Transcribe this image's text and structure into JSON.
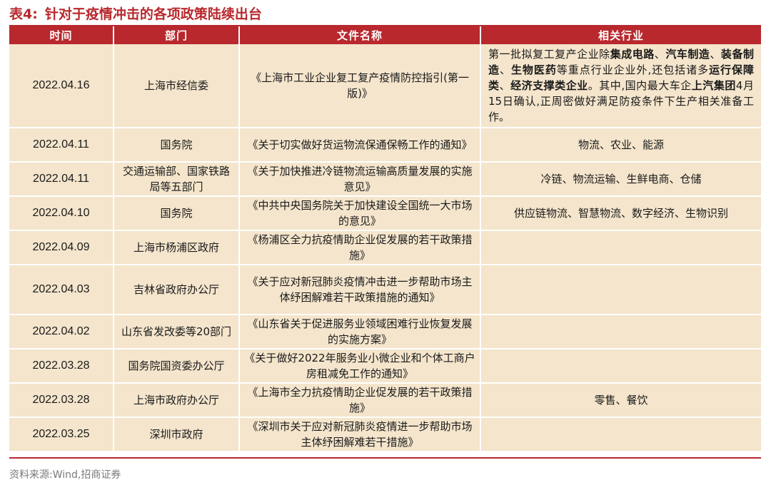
{
  "title": {
    "label": "表4:",
    "text": "针对于疫情冲击的各项政策陆续出台"
  },
  "table": {
    "headers": [
      "时间",
      "部门",
      "文件名称",
      "相关行业"
    ],
    "rows": [
      {
        "date": "2022.04.16",
        "dept": "上海市经信委",
        "doc": "《上海市工业企业复工复产疫情防控指引(第一版)》",
        "industry": ""
      },
      {
        "date": "2022.04.11",
        "dept": "国务院",
        "doc": "《关于切实做好货运物流保通保畅工作的通知》",
        "industry": "物流、农业、能源"
      },
      {
        "date": "2022.04.11",
        "dept": "交通运输部、国家铁路局等五部门",
        "doc": "《关于加快推进冷链物流运输高质量发展的实施意见》",
        "industry": "冷链、物流运输、生鲜电商、仓储"
      },
      {
        "date": "2022.04.10",
        "dept": "国务院",
        "doc": "《中共中央国务院关于加快建设全国统一大市场的意见》",
        "industry": "供应链物流、智慧物流、数字经济、生物识别"
      },
      {
        "date": "2022.04.09",
        "dept": "上海市杨浦区政府",
        "doc": "《杨浦区全力抗疫情助企业促发展的若干政策措施》",
        "industry": ""
      },
      {
        "date": "2022.04.03",
        "dept": "吉林省政府办公厅",
        "doc": "《关于应对新冠肺炎疫情冲击进一步帮助市场主体纾困解难若干政策措施的通知》",
        "industry": ""
      },
      {
        "date": "2022.04.02",
        "dept": "山东省发改委等20部门",
        "doc": "《山东省关于促进服务业领域困难行业恢复发展的实施方案》",
        "industry": ""
      },
      {
        "date": "2022.03.28",
        "dept": "国务院国资委办公厅",
        "doc": "《关于做好2022年服务业小微企业和个体工商户房租减免工作的通知》",
        "industry": ""
      },
      {
        "date": "2022.03.28",
        "dept": "上海市政府办公厅",
        "doc": "《上海市全力抗疫情助企业促发展的若干政策措施》",
        "industry": "零售、餐饮"
      },
      {
        "date": "2022.03.25",
        "dept": "深圳市政府",
        "doc": "《深圳市关于应对新冠肺炎疫情进一步帮助市场主体纾困解难若干措施》",
        "industry": ""
      }
    ],
    "first_industry": {
      "t1": "第一批拟复工复产企业除",
      "b1": "集成电路",
      "t2": "、",
      "b2": "汽车制造",
      "t3": "、",
      "b3": "装备制造",
      "t4": "、",
      "b4": "生物医药",
      "t5": "等重点行业企业外,还包括诸多",
      "b5": "运行保障类",
      "t6": "、",
      "b6": "经济支撑类企业",
      "t7": "。其中,国内最大车企",
      "b7": "上汽集团",
      "t8": "4月15日确认,正周密做好满足防疫条件下生产相关准备工作。"
    }
  },
  "source": "资料来源:Wind,招商证券"
}
